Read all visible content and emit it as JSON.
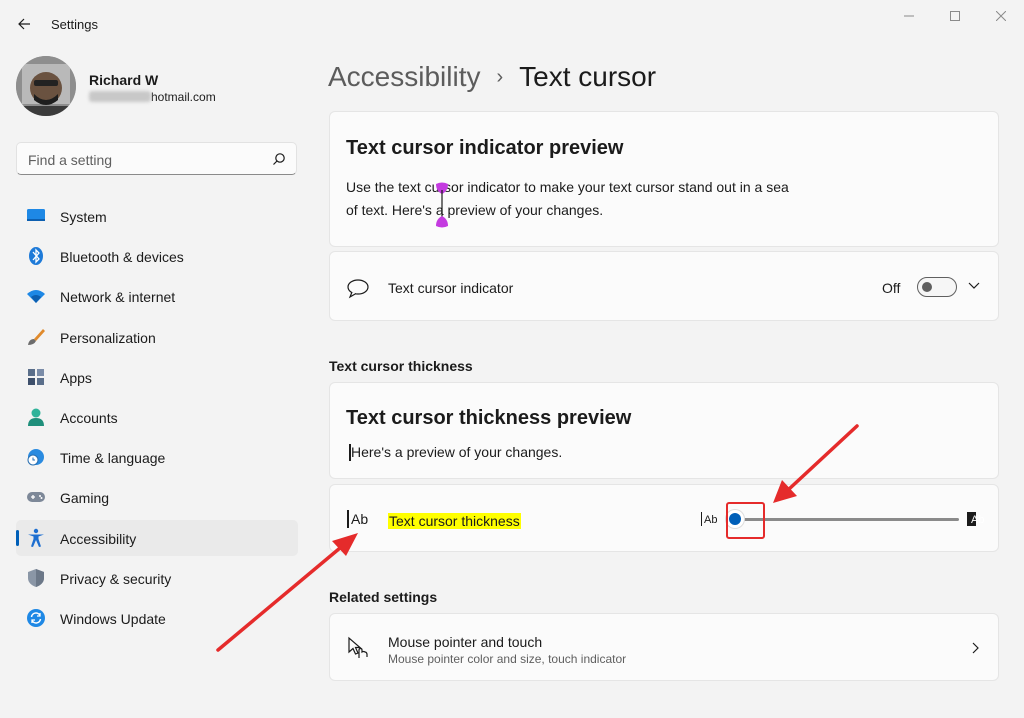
{
  "window": {
    "title": "Settings"
  },
  "profile": {
    "name": "Richard W",
    "email_suffix": "hotmail.com"
  },
  "search": {
    "placeholder": "Find a setting"
  },
  "sidebar": {
    "items": [
      {
        "label": "System",
        "icon": "system-icon"
      },
      {
        "label": "Bluetooth & devices",
        "icon": "bluetooth-icon"
      },
      {
        "label": "Network & internet",
        "icon": "wifi-icon"
      },
      {
        "label": "Personalization",
        "icon": "brush-icon"
      },
      {
        "label": "Apps",
        "icon": "apps-icon"
      },
      {
        "label": "Accounts",
        "icon": "person-icon"
      },
      {
        "label": "Time & language",
        "icon": "globe-clock-icon"
      },
      {
        "label": "Gaming",
        "icon": "gamepad-icon"
      },
      {
        "label": "Accessibility",
        "icon": "accessibility-icon",
        "active": true
      },
      {
        "label": "Privacy & security",
        "icon": "shield-icon"
      },
      {
        "label": "Windows Update",
        "icon": "update-icon"
      }
    ]
  },
  "breadcrumb": {
    "parent": "Accessibility",
    "separator": "›",
    "current": "Text cursor"
  },
  "indicator_preview": {
    "title": "Text cursor indicator preview",
    "line1": "Use the text cursor indicator to make your text cursor stand out in a sea",
    "line2": "of text. Here's a preview of your changes."
  },
  "indicator_row": {
    "label": "Text cursor indicator",
    "state": "Off",
    "toggle_on": false
  },
  "thickness_section": {
    "header": "Text cursor thickness"
  },
  "thickness_preview": {
    "title": "Text cursor thickness preview",
    "text": "Here's a preview of your changes."
  },
  "thickness_row": {
    "icon_text": "Ab",
    "label": "Text cursor thickness",
    "slider_min_text": "Ab",
    "slider_max_text": "Ab",
    "slider_value_fraction": 0.0
  },
  "related": {
    "header": "Related settings",
    "items": [
      {
        "title": "Mouse pointer and touch",
        "subtitle": "Mouse pointer color and size, touch indicator"
      }
    ]
  },
  "colors": {
    "accent": "#005fb8",
    "highlight": "#ffff00",
    "annotation_red": "#e52b2b",
    "indicator_purple": "#c43be0"
  }
}
